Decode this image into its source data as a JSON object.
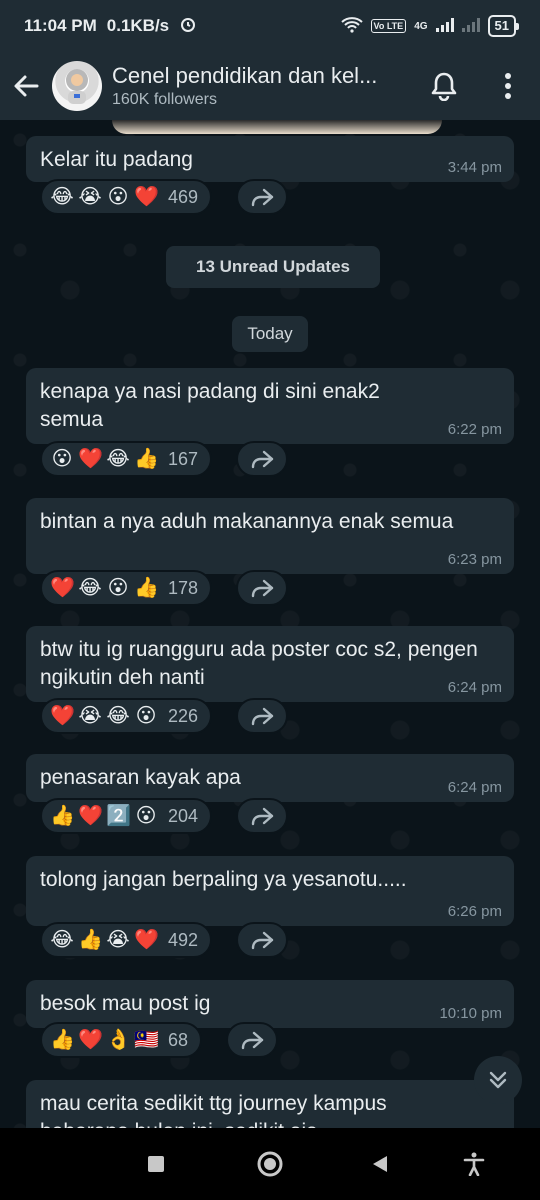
{
  "status_bar": {
    "time": "11:04 PM",
    "speed": "0.1KB/s",
    "network": "4G",
    "volte": "Vo LTE",
    "battery": "51"
  },
  "header": {
    "title": "Cenel pendidikan dan kel...",
    "followers": "160K followers"
  },
  "previous_message": {
    "text": "Kelar itu padang",
    "time": "3:44 pm",
    "reactions": [
      "😂",
      "😭",
      "😮",
      "❤️"
    ],
    "count": "469"
  },
  "unread_label": "13 Unread Updates",
  "date_label": "Today",
  "messages": [
    {
      "text": "kenapa ya nasi padang di sini enak2 semua",
      "time": "6:22 pm",
      "reactions": [
        "😮",
        "❤️",
        "😂",
        "👍"
      ],
      "count": "167"
    },
    {
      "text": "bintan a nya aduh makanannya enak semua",
      "time": "6:23 pm",
      "reactions": [
        "❤️",
        "😂",
        "😮",
        "👍"
      ],
      "count": "178"
    },
    {
      "text": "btw itu ig ruangguru ada poster coc s2, pengen ngikutin deh nanti",
      "time": "6:24 pm",
      "reactions": [
        "❤️",
        "😭",
        "😂",
        "😮"
      ],
      "count": "226"
    },
    {
      "text": "penasaran kayak apa",
      "time": "6:24 pm",
      "reactions": [
        "👍",
        "❤️",
        "2️⃣",
        "😮"
      ],
      "count": "204"
    },
    {
      "text": "tolong jangan berpaling ya yesanotu.....",
      "time": "6:26 pm",
      "reactions": [
        "😂",
        "👍",
        "😭",
        "❤️"
      ],
      "count": "492"
    },
    {
      "text": "besok mau post ig",
      "time": "10:10 pm",
      "reactions": [
        "👍",
        "❤️",
        "👌",
        "🇲🇾"
      ],
      "count": "68"
    },
    {
      "text": "mau cerita sedikit ttg journey kampus beberapa bulan ini, sedikit aja",
      "time": "",
      "reactions": [],
      "count": ""
    }
  ],
  "icons": {
    "back": "arrow-left-icon",
    "bell": "bell-icon",
    "more": "more-vertical-icon",
    "forward": "forward-icon",
    "scroll_down": "chevron-double-down-icon"
  },
  "colors": {
    "background": "#0b141a",
    "bubble": "#1f2c34",
    "text": "#e9edef",
    "meta": "#8696a0"
  }
}
